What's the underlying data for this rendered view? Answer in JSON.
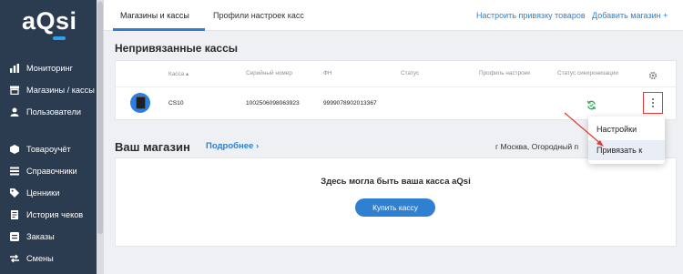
{
  "sidebar": {
    "logo": "aQsi",
    "items": [
      {
        "label": "Мониторинг",
        "icon": "bar-chart-icon"
      },
      {
        "label": "Магазины / кассы",
        "icon": "store-icon"
      },
      {
        "label": "Пользователи",
        "icon": "user-icon"
      },
      {
        "label": "Товароучёт",
        "icon": "box-icon"
      },
      {
        "label": "Справочники",
        "icon": "list-icon"
      },
      {
        "label": "Ценники",
        "icon": "tag-icon"
      },
      {
        "label": "История чеков",
        "icon": "receipt-icon"
      },
      {
        "label": "Заказы",
        "icon": "orders-icon"
      },
      {
        "label": "Смены",
        "icon": "swap-icon"
      }
    ],
    "active_index": 1
  },
  "header": {
    "tabs": [
      {
        "label": "Магазины и кассы"
      },
      {
        "label": "Профили настроек касс"
      }
    ],
    "links": {
      "bind_goods": "Настроить привязку товаров",
      "add_store": "Добавить магазин +"
    }
  },
  "unlinked": {
    "title": "Непривязанные кассы",
    "columns": {
      "kassa": "Касса ▴",
      "serial": "Серийный номер",
      "fn": "ФН",
      "status": "Статус",
      "profile": "Профиль настроек",
      "sync": "Статус синхронизации"
    },
    "row": {
      "kassa": "CS10",
      "serial": "1002506098063923",
      "fn": "9999078902013367",
      "status": "",
      "profile": "",
      "device_color": "#2c7fe0",
      "sync_icon": "sync-icon",
      "sync_color": "#2fae5a"
    }
  },
  "store": {
    "title": "Ваш магазин",
    "more_link": "Подробнее",
    "address": "г Москва, Огородный п",
    "placeholder": "Здесь могла быть ваша касса aQsi",
    "buy_button": "Купить кассу"
  },
  "dropdown": {
    "items": [
      {
        "label": "Настройки"
      },
      {
        "label": "Привязать к"
      }
    ],
    "hover_index": 1
  },
  "colors": {
    "sidebar": "#2b3b50",
    "accent": "#2f80d1",
    "highlight": "#e53935"
  }
}
